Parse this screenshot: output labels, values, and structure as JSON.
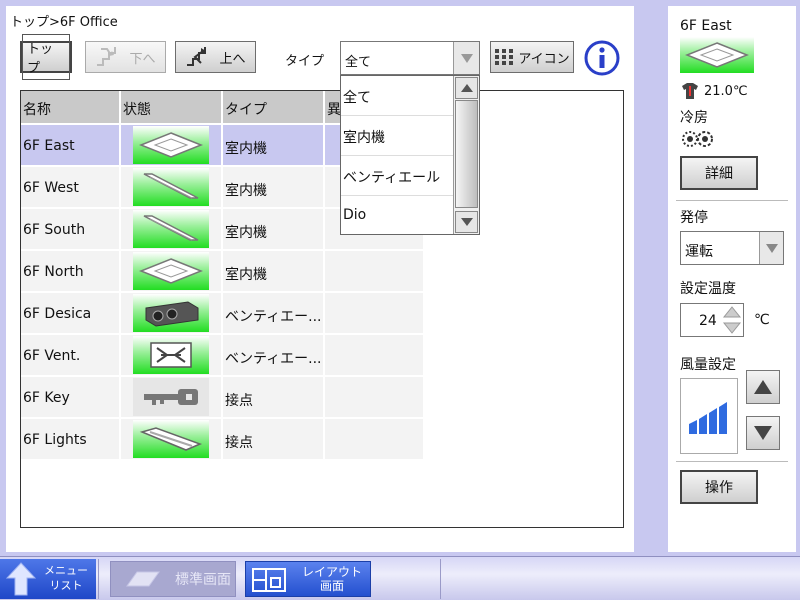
{
  "breadcrumb": "トップ>6F Office",
  "toolbar": {
    "top_label": "トップ",
    "down_label": "下へ",
    "up_label": "上へ",
    "type_label": "タイプ",
    "type_selected": "全て",
    "icon_label": "アイコン"
  },
  "table": {
    "headers": [
      "名称",
      "状態",
      "タイプ",
      "異"
    ],
    "rows": [
      {
        "name": "6F East",
        "type": "室内機",
        "icon": "ceiling-cassette-icon",
        "selected": true
      },
      {
        "name": "6F West",
        "type": "室内機",
        "icon": "ceiling-slim-icon"
      },
      {
        "name": "6F South",
        "type": "室内機",
        "icon": "ceiling-slim-icon"
      },
      {
        "name": "6F North",
        "type": "室内機",
        "icon": "ceiling-cassette-icon"
      },
      {
        "name": "6F Desica",
        "type": "ベンティエー...",
        "icon": "desica-unit-icon"
      },
      {
        "name": "6F Vent.",
        "type": "ベンティエー...",
        "icon": "ventilation-icon"
      },
      {
        "name": "6F Key",
        "type": "接点",
        "icon": "key-icon"
      },
      {
        "name": "6F Lights",
        "type": "接点",
        "icon": "light-fixture-icon"
      }
    ]
  },
  "type_dropdown": {
    "options": [
      "全て",
      "室内機",
      "ベンティエール",
      "Dio"
    ]
  },
  "detail": {
    "unit_name": "6F East",
    "room_temp": "21.0℃",
    "mode": "冷房",
    "detail_button": "詳細",
    "onoff_label": "発停",
    "onoff_value": "運転",
    "setpoint_label": "設定温度",
    "setpoint_value": "24",
    "setpoint_unit": "℃",
    "fan_label": "風量設定",
    "operate_button": "操作"
  },
  "bottom": {
    "menu_line1": "メニュー",
    "menu_line2": "リスト",
    "standard_label": "標準画面",
    "layout_line1": "レイアウト",
    "layout_line2": "画面"
  },
  "colors": {
    "panel_lavender": "#c8c8f0",
    "status_green": "#22dd22",
    "accent_blue": "#1f47c8"
  }
}
